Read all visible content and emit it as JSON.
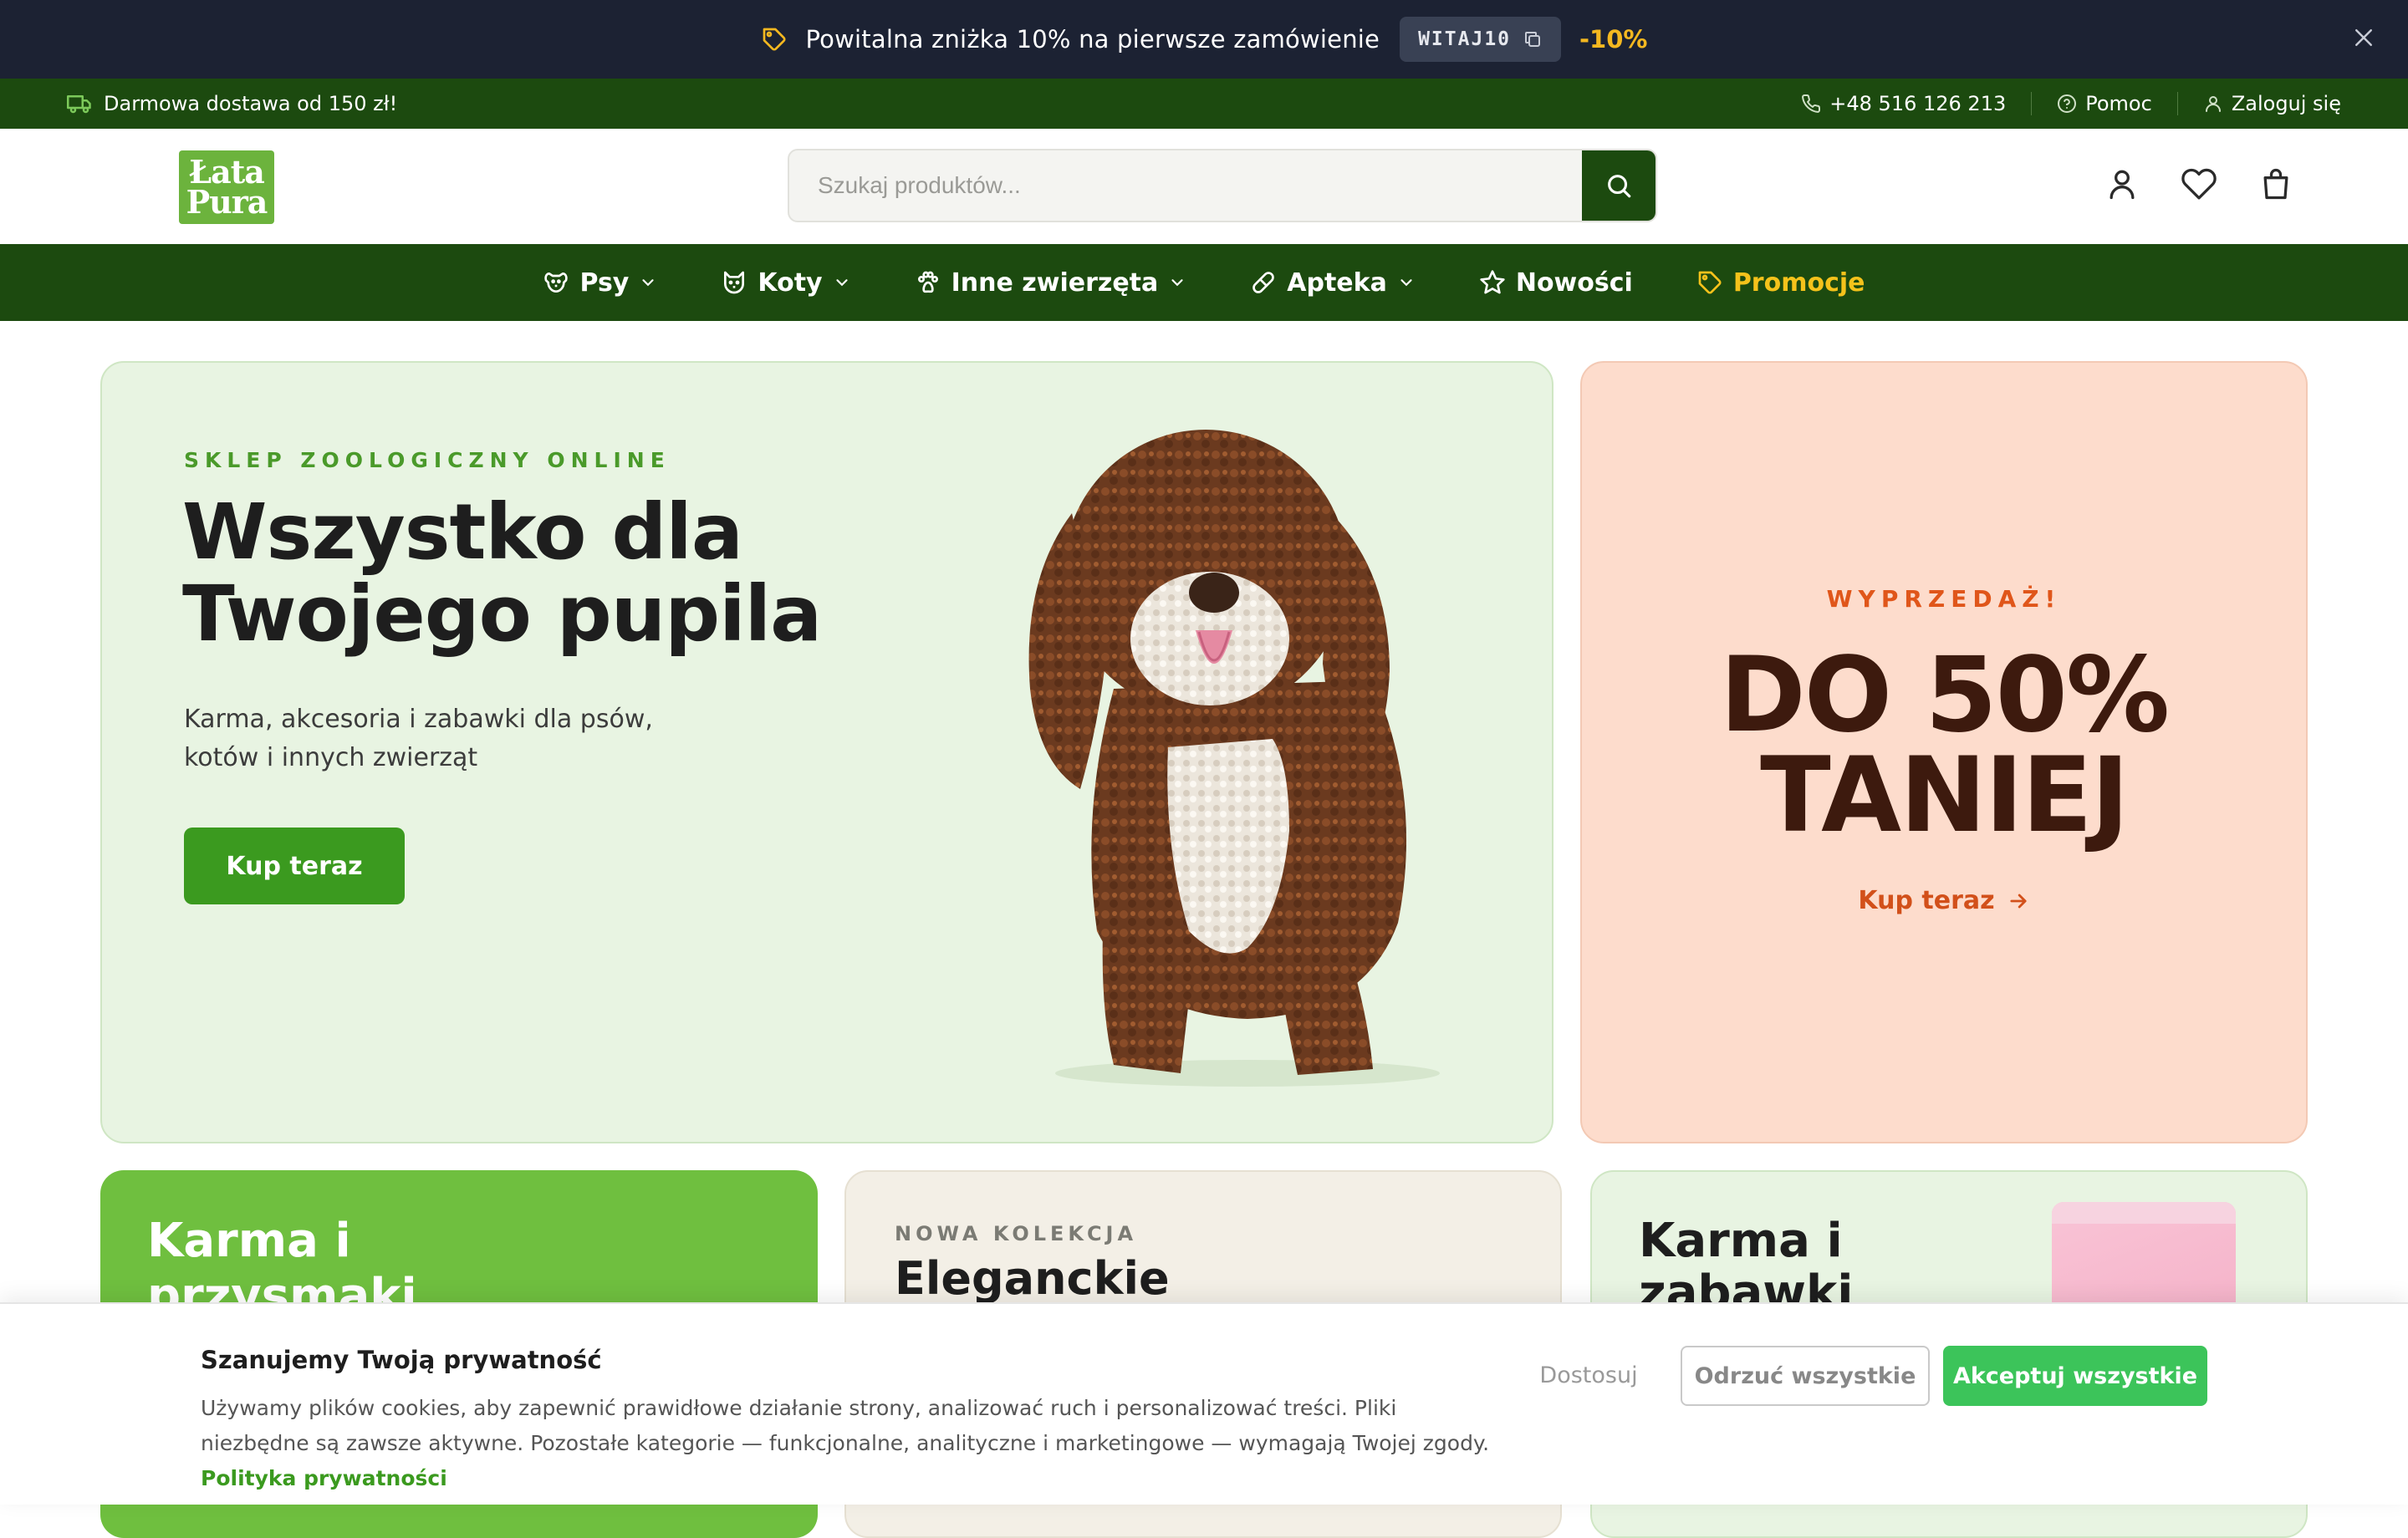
{
  "promo_bar": {
    "text": "Powitalna zniżka 10% na pierwsze zamówienie",
    "code": "WITAJ10",
    "discount": "-10%"
  },
  "utility_bar": {
    "shipping": "Darmowa dostawa od 150 zł!",
    "phone": "+48 516 126 213",
    "help": "Pomoc",
    "login": "Zaloguj się"
  },
  "header": {
    "logo_line1": "Łata",
    "logo_line2": "Pura",
    "search_placeholder": "Szukaj produktów..."
  },
  "nav": {
    "items": [
      {
        "label": "Psy",
        "icon": "dog-icon",
        "dropdown": true
      },
      {
        "label": "Koty",
        "icon": "cat-icon",
        "dropdown": true
      },
      {
        "label": "Inne zwierzęta",
        "icon": "paw-icon",
        "dropdown": true
      },
      {
        "label": "Apteka",
        "icon": "pill-icon",
        "dropdown": true
      },
      {
        "label": "Nowości",
        "icon": "star-icon",
        "dropdown": false
      },
      {
        "label": "Promocje",
        "icon": "tag-icon",
        "dropdown": false
      }
    ]
  },
  "hero": {
    "eyebrow": "SKLEP ZOOLOGICZNY ONLINE",
    "title_line1": "Wszystko dla",
    "title_line2": "Twojego pupila",
    "description": "Karma, akcesoria i zabawki dla psów, kotów i innych zwierząt",
    "cta": "Kup teraz"
  },
  "sale_card": {
    "eyebrow": "WYPRZEDAŻ!",
    "line1": "DO 50%",
    "line2": "TANIEJ",
    "cta": "Kup teraz"
  },
  "category_cards": [
    {
      "title": "Karma i przysmaki"
    },
    {
      "eyebrow": "NOWA KOLEKCJA",
      "title": "Eleganckie"
    },
    {
      "title": "Karma i zabawki"
    }
  ],
  "cookie": {
    "title": "Szanujemy Twoją prywatność",
    "text": "Używamy plików cookies, aby zapewnić prawidłowe działanie strony, analizować ruch i personalizować treści. Pliki niezbędne są zawsze aktywne. Pozostałe kategorie — funkcjonalne, analityczne i marketingowe — wymagają Twojej zgody.",
    "policy_link": "Polityka prywatności",
    "customize": "Dostosuj",
    "reject": "Odrzuć wszystkie",
    "accept": "Akceptuj wszystkie"
  },
  "colors": {
    "promo_bg": "#1c2233",
    "nav_green": "#1c4a0f",
    "accent_green": "#3b9a1f",
    "hero_bg": "#e8f4e2",
    "sale_bg": "#fddccc",
    "promo_yellow": "#f5b820",
    "accept_green": "#3cc45a"
  }
}
